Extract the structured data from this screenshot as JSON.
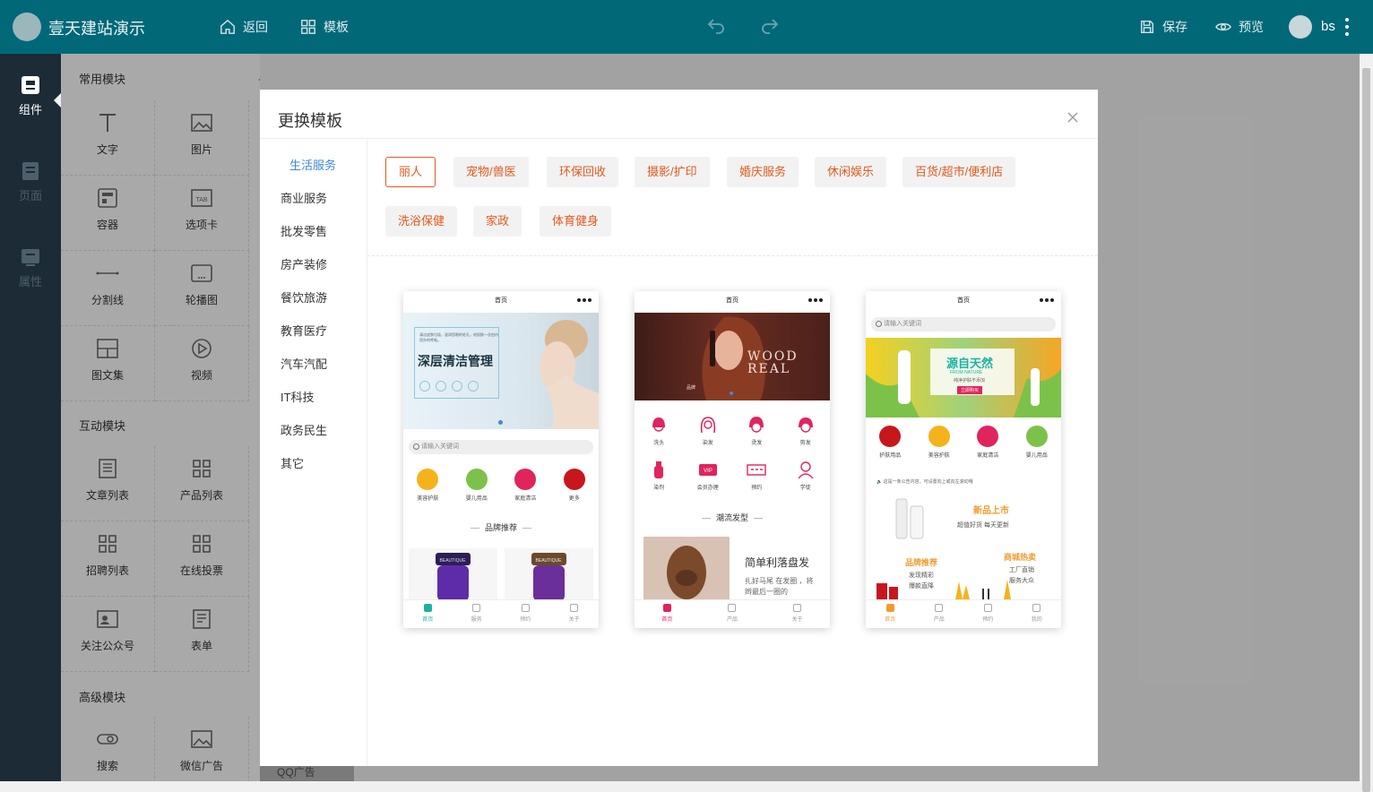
{
  "app": {
    "title": "壹天建站演示",
    "user": "bs"
  },
  "topnav": {
    "back": "返回",
    "template": "模板",
    "save": "保存",
    "preview": "预览"
  },
  "leftbar": [
    {
      "label": "组件"
    },
    {
      "label": "页面"
    },
    {
      "label": "属性"
    }
  ],
  "panel": {
    "common_title": "常用模块",
    "interactive_title": "互动模块",
    "advanced_title": "高级模块",
    "modules": [
      "文字",
      "图片",
      "容器",
      "选项卡",
      "分割线",
      "轮播图",
      "图文集",
      "视频",
      "文章列表",
      "产品列表",
      "招聘列表",
      "在线投票",
      "关注公众号",
      "表单",
      "搜索",
      "微信广告",
      "QQ广告"
    ],
    "tab_glyph": "TAB"
  },
  "modal": {
    "title": "更换模板",
    "categories": [
      "生活服务",
      "商业服务",
      "批发零售",
      "房产装修",
      "餐饮旅游",
      "教育医疗",
      "汽车汽配",
      "IT科技",
      "政务民生",
      "其它"
    ],
    "tags": [
      "丽人",
      "宠物/兽医",
      "环保回收",
      "摄影/扩印",
      "婚庆服务",
      "休闲娱乐",
      "百货/超市/便利店",
      "洗浴保健",
      "家政",
      "体育健身"
    ]
  },
  "templates": [
    {
      "header": "首页",
      "banner_title": "深层清洁管理",
      "banner_text": "清洁皮肤垃圾，滋润您眼的毛孔，给肌肤一次由内而外的呼吸。",
      "search": "请输入关键词",
      "icons": [
        "美容护肤",
        "婴儿用品",
        "家庭清洁",
        "更多"
      ],
      "section": "品牌推荐",
      "product_label": "BEAUTIQUE",
      "tabs": [
        "首页",
        "服务",
        "预约",
        "关于"
      ]
    },
    {
      "header": "首页",
      "banner_title": "WOOD REAL",
      "banner_tag": "品牌",
      "icons": [
        "洗头",
        "染发",
        "烫发",
        "剪发",
        "染剂",
        "会员办理",
        "预约",
        "学徒"
      ],
      "vip": "VIP",
      "section": "潮流发型",
      "article_title": "简单利落盘发",
      "article_text": "扎好马尾 在发圈 ，将辫最后一圈的",
      "tabs": [
        "首页",
        "产品",
        "关于"
      ]
    },
    {
      "header": "首页",
      "search": "请输入关键词",
      "banner_title": "源自天然",
      "banner_en": "FROM NATURE",
      "banner_sub": "纯净护肤不添加",
      "banner_btn": "立即购买",
      "icons": [
        "护肤用品",
        "美容护肤",
        "家庭清洁",
        "婴儿用品"
      ],
      "notice": "这是一条公告内容，可设置向上或向左滚动哦",
      "new_title": "新品上市",
      "new_sub": "超值好货 每天更新",
      "brand_title": "品牌推荐",
      "brand_sub1": "发现精彩",
      "brand_sub2": "爆款直降",
      "shop_title": "商城热卖",
      "shop_sub1": "工厂直销",
      "shop_sub2": "服务大众",
      "tabs": [
        "首页",
        "产品",
        "预约",
        "我的"
      ]
    }
  ],
  "colors": {
    "topbar": "#016878",
    "sidebar": "#1c2b36",
    "accent": "#e25a1c",
    "link": "#3b8ad6",
    "teal": "#19b3a0",
    "pink": "#e0245e",
    "orange": "#f29a2e"
  }
}
